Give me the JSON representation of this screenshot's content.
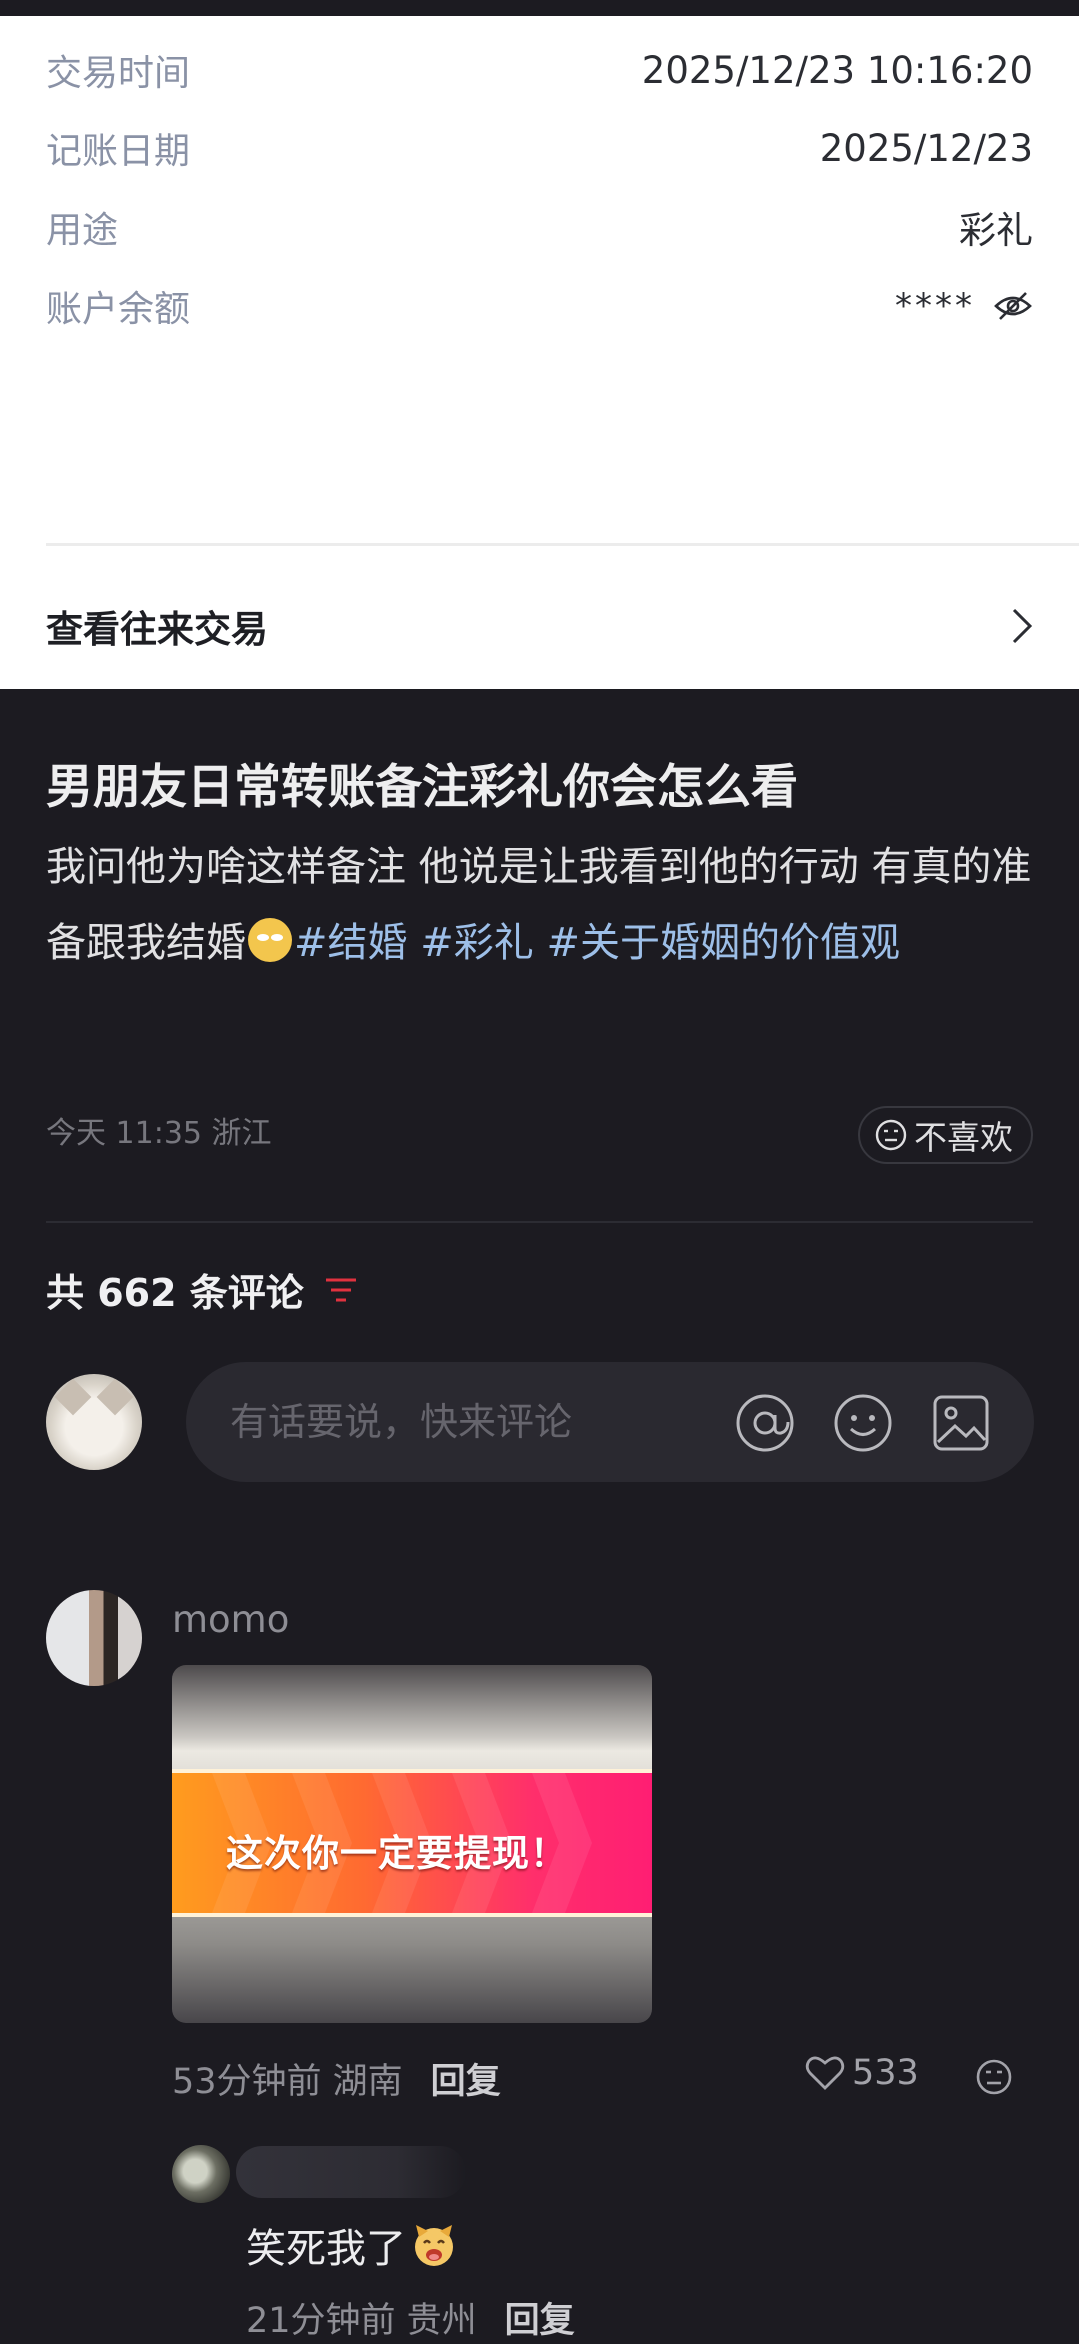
{
  "receipt": {
    "rows": [
      {
        "label": "交易时间",
        "value": "2025/12/23 10:16:20"
      },
      {
        "label": "记账日期",
        "value": "2025/12/23"
      },
      {
        "label": "用途",
        "value": "彩礼"
      },
      {
        "label": "账户余额",
        "value": "****"
      }
    ],
    "balance_icon": "eye-off-icon",
    "history_label": "查看往来交易"
  },
  "post": {
    "title": "男朋友日常转账备注彩礼你会怎么看",
    "description_text": "我问他为啥这样备注 他说是让我看到他的行动 有真的准备跟我结婚",
    "tags": [
      "#结婚",
      "#彩礼",
      "#关于婚姻的价值观"
    ],
    "meta": "今天 11:35 浙江",
    "dislike_label": "不喜欢"
  },
  "comments_header": {
    "count_label": "共 662 条评论",
    "accent_color": "#e0323f"
  },
  "comment_input": {
    "placeholder": "有话要说，快来评论",
    "icons": [
      "at-icon",
      "emoji-icon",
      "image-icon"
    ]
  },
  "comments": [
    {
      "username": "momo",
      "sticker_text": "这次你一定要提现！",
      "time_location": "53分钟前 湖南",
      "reply_label": "回复",
      "likes": "533",
      "replies": [
        {
          "text": "笑死我了",
          "time_location": "21分钟前 贵州",
          "reply_label": "回复"
        }
      ]
    }
  ]
}
